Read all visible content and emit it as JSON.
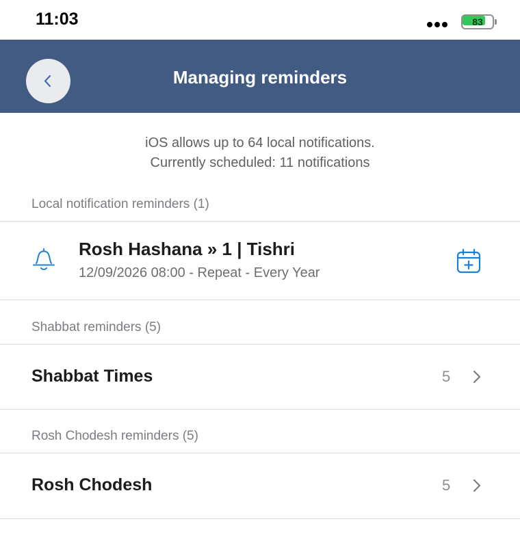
{
  "status_bar": {
    "time": "11:03",
    "battery_level": "83",
    "battery_color": "#34c759"
  },
  "nav": {
    "title": "Managing reminders",
    "back_icon": "chevron-left-icon",
    "background_color": "#425b83"
  },
  "info": {
    "line1": "iOS allows up to 64 local notifications.",
    "line2": "Currently scheduled: 11 notifications"
  },
  "sections": {
    "local": {
      "header": "Local notification reminders (1)",
      "item": {
        "icon": "bell-icon",
        "title": "Rosh Hashana » 1 | Tishri",
        "subtitle": "12/09/2026 08:00 - Repeat - Every Year",
        "action_icon": "calendar-plus-icon"
      }
    },
    "shabbat": {
      "header": "Shabbat reminders (5)",
      "item": {
        "title": "Shabbat Times",
        "count": "5"
      }
    },
    "rosh_chodesh": {
      "header": "Rosh Chodesh reminders (5)",
      "item": {
        "title": "Rosh Chodesh",
        "count": "5"
      }
    }
  },
  "accent_color": "#1a7fd6"
}
